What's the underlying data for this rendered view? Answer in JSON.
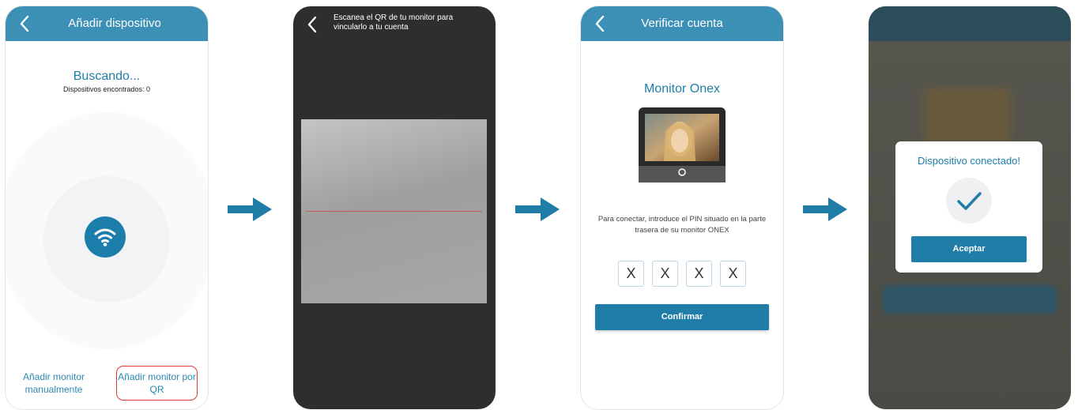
{
  "colors": {
    "accent": "#3c8fb5",
    "button": "#1f7da8",
    "highlight_border": "#d93a3a"
  },
  "screen1": {
    "title": "Añadir dispositivo",
    "status": "Buscando...",
    "found": "Dispositivos encontrados: 0",
    "icon": "wifi-icon",
    "link_manual": "Añadir monitor manualmente",
    "link_qr": "Añadir monitor por QR"
  },
  "screen2": {
    "instruction": "Escanea el QR de tu monitor para vincularlo a tu cuenta"
  },
  "screen3": {
    "title": "Verificar cuenta",
    "monitor_name": "Monitor Onex",
    "instruction": "Para conectar, introduce el PIN situado en la parte trasera de su monitor ONEX",
    "pin": [
      "X",
      "X",
      "X",
      "X"
    ],
    "confirm_label": "Confirmar"
  },
  "screen4": {
    "modal_title": "Dispositivo conectado!",
    "accept_label": "Aceptar"
  }
}
